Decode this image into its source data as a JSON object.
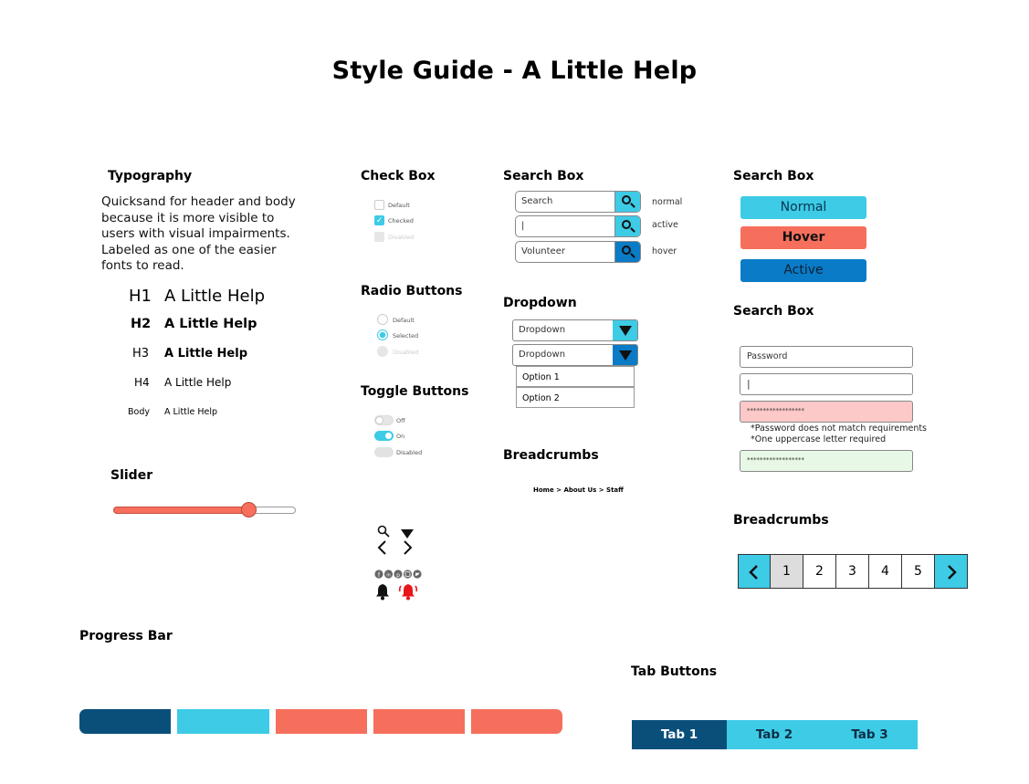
{
  "title": "Style Guide - A Little Help",
  "colors": {
    "dark_blue": "#0a4f7a",
    "cyan": "#3dcbe6",
    "coral": "#f66f5d",
    "blue": "#0a7bc6",
    "error_bg": "#fcc8c8",
    "ok_bg": "#e8f8e6"
  },
  "typography": {
    "heading": "Typography",
    "description": "Quicksand for header and body because it is more visible to users with visual impairments. Labeled as one of the easier fonts to read.",
    "samples": [
      {
        "label": "H1",
        "text": "A Little Help"
      },
      {
        "label": "H2",
        "text": "A Little Help"
      },
      {
        "label": "H3",
        "text": "A Little Help"
      },
      {
        "label": "H4",
        "text": "A Little Help"
      },
      {
        "label": "Body",
        "text": "A Little Help"
      }
    ]
  },
  "slider": {
    "heading": "Slider",
    "value_fraction": 0.74
  },
  "checkbox": {
    "heading": "Check Box",
    "items": [
      "Default",
      "Checked",
      "Disabled"
    ]
  },
  "radio": {
    "heading": "Radio Buttons",
    "items": [
      "Default",
      "Selected",
      "Disabled"
    ]
  },
  "toggle": {
    "heading": "Toggle Buttons",
    "items": [
      "Off",
      "On",
      "Disabled"
    ]
  },
  "search_box": {
    "heading": "Search Box",
    "rows": [
      {
        "value": "Search",
        "state": "normal"
      },
      {
        "value": "|",
        "state": "active"
      },
      {
        "value": "Volunteer",
        "state": "hover"
      }
    ]
  },
  "dropdown": {
    "heading": "Dropdown",
    "closed_label": "Dropdown",
    "open_label": "Dropdown",
    "options": [
      "Option 1",
      "Option 2"
    ]
  },
  "breadcrumbs": {
    "heading": "Breadcrumbs",
    "trail": "Home > About Us > Staff"
  },
  "buttons": {
    "heading": "Search Box",
    "normal": "Normal",
    "hover": "Hover",
    "active": "Active"
  },
  "password": {
    "heading": "Search Box",
    "placeholder": "Password",
    "active_value": "|",
    "masked_error": "******************",
    "errors": [
      "*Password does not match requirements",
      "*One uppercase letter required"
    ],
    "masked_ok": "******************"
  },
  "pagination": {
    "heading": "Breadcrumbs",
    "pages": [
      "1",
      "2",
      "3",
      "4",
      "5"
    ],
    "selected": "1"
  },
  "progress": {
    "heading": "Progress Bar",
    "segments": 5,
    "completed": 1
  },
  "tabs": {
    "heading": "Tab Buttons",
    "items": [
      "Tab 1",
      "Tab 2",
      "Tab 3"
    ],
    "active": "Tab 1"
  },
  "icons": [
    "search-icon",
    "caret-down-icon",
    "chevron-left-icon",
    "chevron-right-icon",
    "facebook-icon",
    "linkedin-icon",
    "pinterest-icon",
    "instagram-icon",
    "twitter-icon",
    "bell-icon",
    "bell-ringing-icon"
  ]
}
